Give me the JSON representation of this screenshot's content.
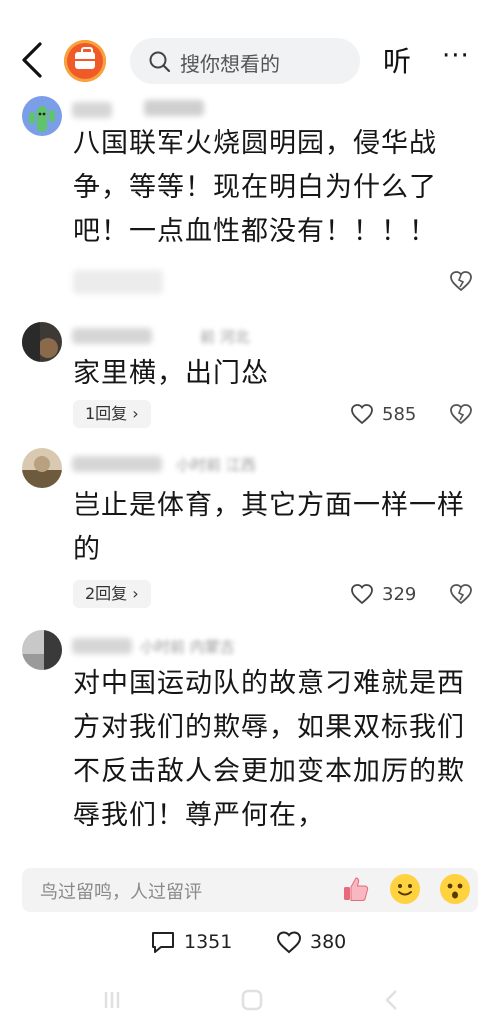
{
  "topbar": {
    "search_placeholder": "搜你想看的",
    "listen_label": "听",
    "more_label": "···"
  },
  "comments": [
    {
      "text": "八国联军火烧圆明园，侵华战争，等等！现在明白为什么了吧！一点血性都没有！！！！",
      "meta_hint": "",
      "reply_label": "",
      "likes": ""
    },
    {
      "text": "家里横，出门怂",
      "meta_hint": "前 河北",
      "reply_label": "1回复",
      "likes": "585"
    },
    {
      "text": "岂止是体育，其它方面一样一样的",
      "meta_hint": "小时前 江西",
      "reply_label": "2回复",
      "likes": "329"
    },
    {
      "text": "对中国运动队的故意刁难就是西方对我们的欺辱，如果双标我们不反击敌人会更加变本加厉的欺辱我们！尊严何在，",
      "meta_hint": "小时前 内蒙古",
      "reply_label": "",
      "likes": ""
    }
  ],
  "composer": {
    "placeholder": "鸟过留鸣，人过留评"
  },
  "stats": {
    "comment_count": "1351",
    "like_count": "380"
  },
  "colors": {
    "logo": "#f05a28",
    "text": "#161616",
    "muted": "#9a9a9a"
  }
}
